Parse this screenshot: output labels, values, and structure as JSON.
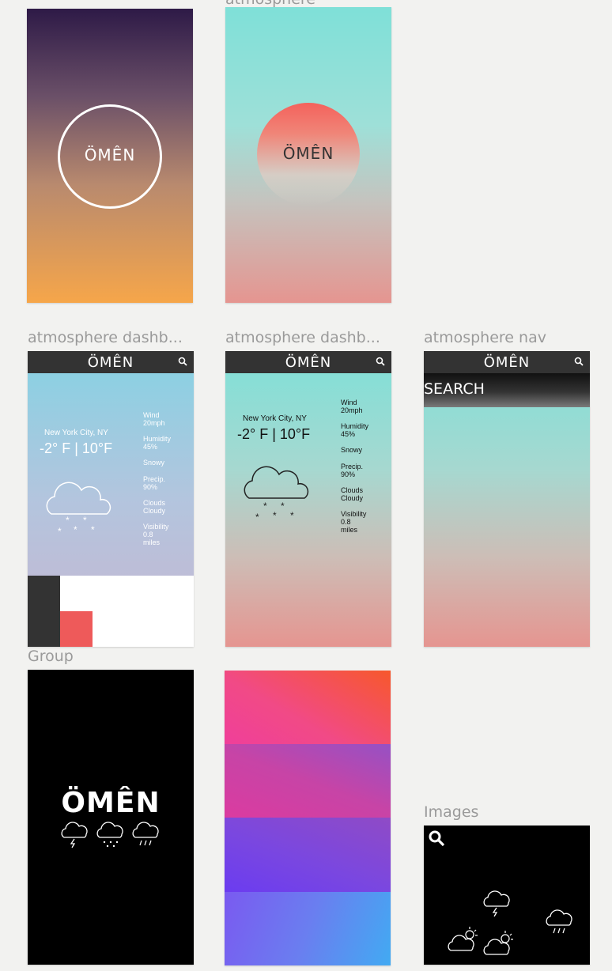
{
  "brand": "ÖMÊN",
  "labels": {
    "top_frame": "atmosphere",
    "dash1": "atmosphere dashb...",
    "dash2": "atmosphere dashb...",
    "nav": "atmosphere nav",
    "group": "Group",
    "images": "Images"
  },
  "weather": {
    "city": "New York City, NY",
    "temp": "-2° F | 10°F",
    "stats": [
      {
        "title": "Wind",
        "value": "20mph"
      },
      {
        "title": "Humidity",
        "value": "45%"
      },
      {
        "title": "Snowy",
        "value": ""
      },
      {
        "title": "Precip.",
        "value": "90%"
      },
      {
        "title": "Clouds",
        "value": "Cloudy"
      },
      {
        "title": "Visibility",
        "value": "0.8 miles"
      }
    ]
  },
  "nav": {
    "search_label": "SEARCH"
  },
  "colors": {
    "dark_bar": "#333333",
    "accent_red": "#ee5a5a",
    "teal": "#7fe0d8",
    "coral": "#e59590",
    "orange": "#f6a64a",
    "purple": "#2e1a47"
  },
  "icons": [
    "search-icon",
    "cloud-snow-icon",
    "cloud-storm-icon",
    "cloud-rain-icon",
    "sun-cloud-icon"
  ]
}
